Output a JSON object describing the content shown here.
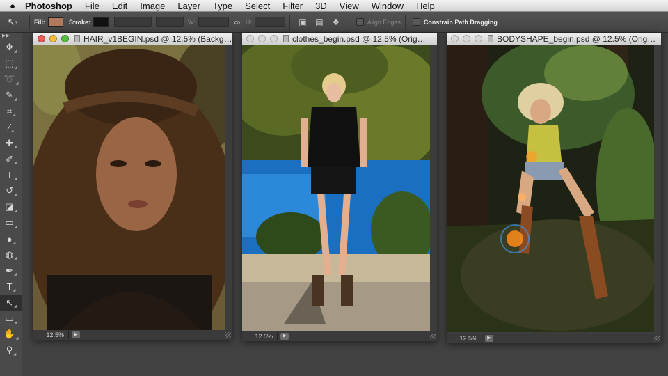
{
  "menubar": {
    "app_name": "Photoshop",
    "items": [
      "File",
      "Edit",
      "Image",
      "Layer",
      "Type",
      "Select",
      "Filter",
      "3D",
      "View",
      "Window",
      "Help"
    ]
  },
  "options_bar": {
    "fill_label": "Fill:",
    "stroke_label": "Stroke:",
    "fill_color": "#b07a5e",
    "stroke_color": "#111111",
    "w_label": "W:",
    "h_label": "H:",
    "align_edges_label": "Align Edges",
    "constrain_label": "Constrain Path Dragging"
  },
  "tools": [
    {
      "name": "move-tool-icon",
      "glyph": "✥"
    },
    {
      "name": "marquee-tool-icon",
      "glyph": "⬚"
    },
    {
      "name": "lasso-tool-icon",
      "glyph": "➰"
    },
    {
      "name": "quick-select-tool-icon",
      "glyph": "✎"
    },
    {
      "name": "crop-tool-icon",
      "glyph": "⌗"
    },
    {
      "name": "eyedropper-tool-icon",
      "glyph": "⁄"
    },
    {
      "name": "healing-brush-tool-icon",
      "glyph": "✚"
    },
    {
      "name": "brush-tool-icon",
      "glyph": "✐"
    },
    {
      "name": "clone-stamp-tool-icon",
      "glyph": "⊥"
    },
    {
      "name": "history-brush-tool-icon",
      "glyph": "↺"
    },
    {
      "name": "eraser-tool-icon",
      "glyph": "◪"
    },
    {
      "name": "gradient-tool-icon",
      "glyph": "▭"
    },
    {
      "name": "blur-tool-icon",
      "glyph": "●"
    },
    {
      "name": "dodge-tool-icon",
      "glyph": "◍"
    },
    {
      "name": "pen-tool-icon",
      "glyph": "✒"
    },
    {
      "name": "type-tool-icon",
      "glyph": "T"
    },
    {
      "name": "path-selection-tool-icon",
      "glyph": "↖"
    },
    {
      "name": "rectangle-tool-icon",
      "glyph": "▭"
    },
    {
      "name": "hand-tool-icon",
      "glyph": "✋"
    },
    {
      "name": "zoom-tool-icon",
      "glyph": "⚲"
    }
  ],
  "documents": [
    {
      "title": "HAIR_v1BEGIN.psd @ 12.5% (Backg…",
      "zoom": "12.5%",
      "active": true
    },
    {
      "title": "clothes_begin.psd @ 12.5% (Orig…",
      "zoom": "12.5%",
      "active": false
    },
    {
      "title": "BODYSHAPE_begin.psd @ 12.5% (Orig…",
      "zoom": "12.5%",
      "active": false
    }
  ]
}
